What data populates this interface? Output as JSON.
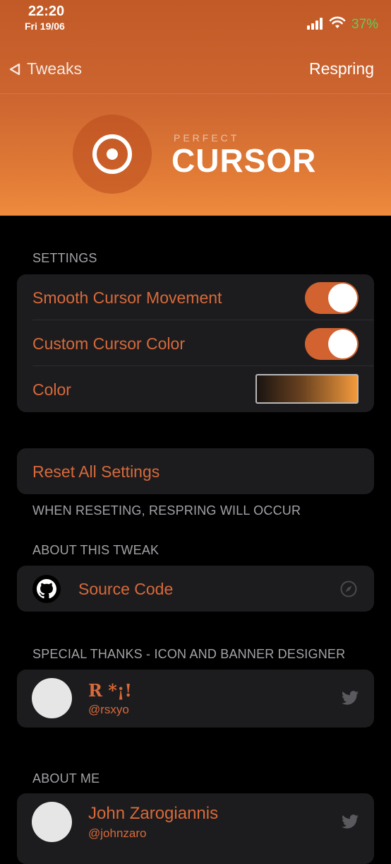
{
  "status": {
    "time": "22:20",
    "date": "Fri 19/06",
    "battery": "37%"
  },
  "nav": {
    "back_label": "Tweaks",
    "action_label": "Respring"
  },
  "banner": {
    "small": "PERFECT",
    "big": "CURSOR"
  },
  "settings": {
    "header": "SETTINGS",
    "smooth_label": "Smooth Cursor Movement",
    "smooth_on": true,
    "custom_color_label": "Custom Cursor Color",
    "custom_color_on": true,
    "color_label": "Color",
    "color_gradient": [
      "#1a1410",
      "#f39a3c"
    ]
  },
  "reset": {
    "label": "Reset All Settings",
    "footer": "WHEN RESETING, RESPRING WILL OCCUR"
  },
  "about_tweak": {
    "header": "ABOUT THIS TWEAK",
    "source_label": "Source Code"
  },
  "thanks": {
    "header": "SPECIAL THANKS - ICON AND BANNER DESIGNER",
    "name": "R *¡!",
    "handle": "@rsxyo"
  },
  "about_me": {
    "header": "ABOUT ME",
    "name": "John Zarogiannis",
    "handle": "@johnzaro"
  },
  "colors": {
    "accent": "#d8693a",
    "cell_bg": "#1c1c1e",
    "toggle_on": "#d2622f"
  }
}
